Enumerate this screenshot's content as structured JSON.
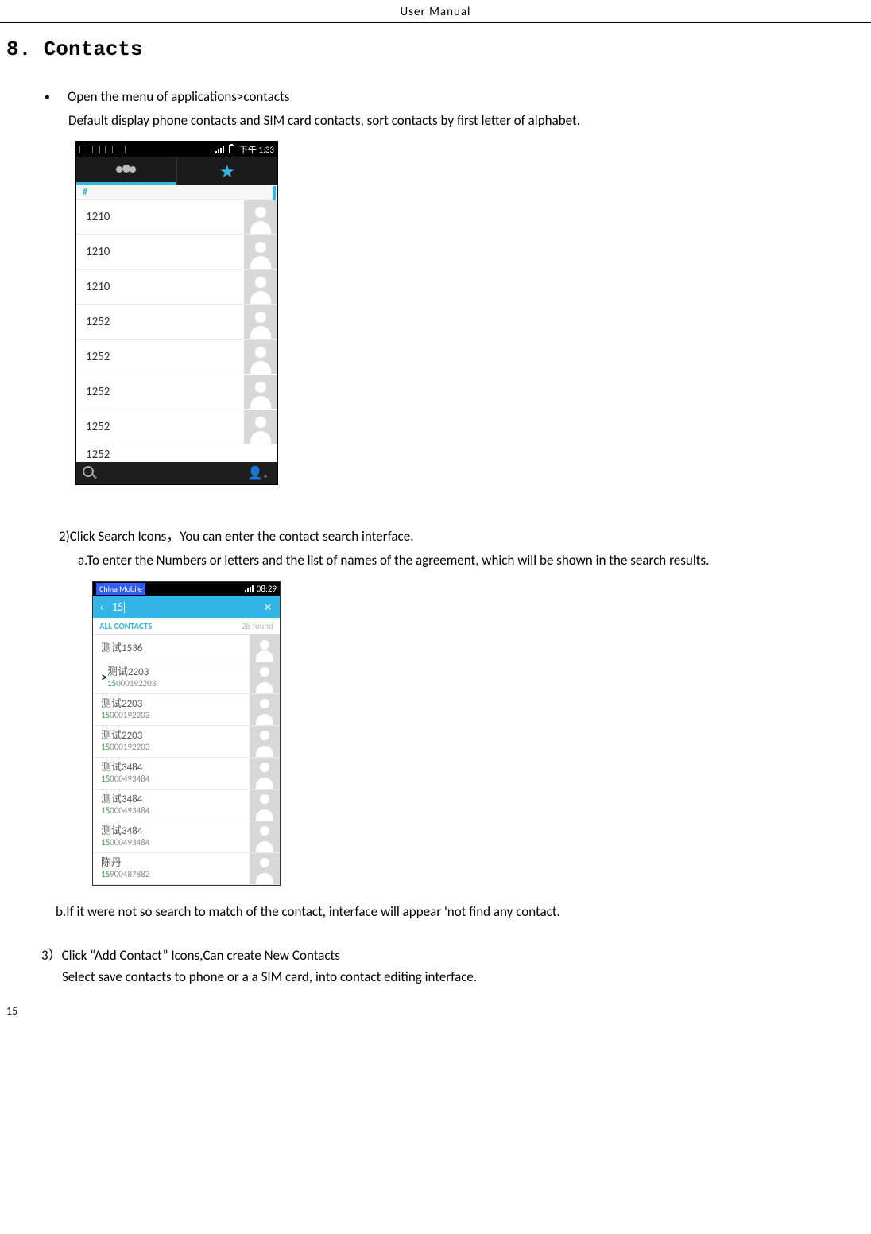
{
  "header": "User    Manual",
  "section_title": "8. Contacts",
  "bullet1": "Open the menu of applications>contacts",
  "para1": "Default display phone contacts and SIM card contacts, sort contacts by first letter of alphabet.",
  "shot1": {
    "time": "下午 1:33",
    "hash": "#",
    "rows": [
      "1210",
      "1210",
      "1210",
      "1252",
      "1252",
      "1252",
      "1252"
    ],
    "lastrow": "1252"
  },
  "para2": "2)Click Search Icons，You can enter the contact search interface.",
  "para3": "a.To enter the Numbers or letters and the list of names of the agreement, which will be shown in the search results.",
  "shot2": {
    "carrier": "China Mobile",
    "time": "08:29",
    "query": "15",
    "filter_label": "ALL CONTACTS",
    "found": "28 found",
    "rows": [
      {
        "name": "测试1536",
        "hl": "",
        "rest": ""
      },
      {
        "name": "测试2203",
        "hl": "15",
        "rest": "000192203"
      },
      {
        "name": "测试2203",
        "hl": "15",
        "rest": "000192203"
      },
      {
        "name": "测试2203",
        "hl": "15",
        "rest": "000192203"
      },
      {
        "name": "测试3484",
        "hl": "15",
        "rest": "000493484"
      },
      {
        "name": "测试3484",
        "hl": "15",
        "rest": "000493484"
      },
      {
        "name": "测试3484",
        "hl": "15",
        "rest": "000493484"
      },
      {
        "name": "陈丹",
        "hl": "15",
        "rest": "900487882"
      }
    ]
  },
  "para4": "b.If it were not so search to match of the contact, interface will appear 'not find any contact.",
  "para5": "3）Click “Add    Contact” Icons,Can create New Contacts",
  "para6": "Select save contacts to phone or a a SIM card, into contact editing interface.",
  "page_num": "15"
}
